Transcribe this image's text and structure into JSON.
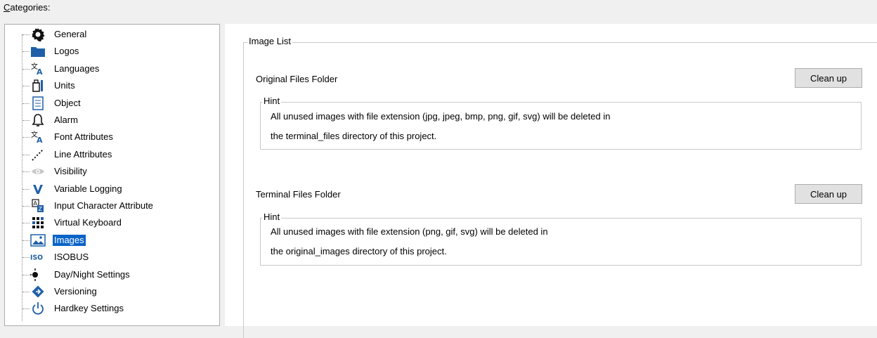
{
  "categories_label_underlined": "C",
  "categories_label_rest": "ategories:",
  "tree": {
    "items": [
      {
        "label": "General",
        "icon": "gear-icon"
      },
      {
        "label": "Logos",
        "icon": "folder-icon"
      },
      {
        "label": "Languages",
        "icon": "language-icon"
      },
      {
        "label": "Units",
        "icon": "units-icon"
      },
      {
        "label": "Object",
        "icon": "document-icon"
      },
      {
        "label": "Alarm",
        "icon": "bell-icon"
      },
      {
        "label": "Font Attributes",
        "icon": "font-icon"
      },
      {
        "label": "Line Attributes",
        "icon": "dotted-line-icon"
      },
      {
        "label": "Visibility",
        "icon": "eye-icon"
      },
      {
        "label": "Variable Logging",
        "icon": "v-icon"
      },
      {
        "label": "Input Character Attribute",
        "icon": "input-char-icon"
      },
      {
        "label": "Virtual Keyboard",
        "icon": "keyboard-icon"
      },
      {
        "label": "Images",
        "icon": "image-icon",
        "selected": true
      },
      {
        "label": "ISOBUS",
        "icon": "iso-icon"
      },
      {
        "label": "Day/Night Settings",
        "icon": "day-night-icon"
      },
      {
        "label": "Versioning",
        "icon": "versioning-icon"
      },
      {
        "label": "Hardkey Settings",
        "icon": "power-icon"
      }
    ]
  },
  "image_list": {
    "title": "Image List",
    "original": {
      "label": "Original Files Folder",
      "button": "Clean up",
      "hint_title": "Hint",
      "hint_line1": "All unused images with file extension (jpg, jpeg, bmp, png, gif, svg) will be deleted in",
      "hint_line2": "the terminal_files directory of this project."
    },
    "terminal": {
      "label": "Terminal Files Folder",
      "button": "Clean up",
      "hint_title": "Hint",
      "hint_line1": "All unused images with file extension (png, gif, svg) will be deleted in",
      "hint_line2": "the original_images directory of this project."
    }
  },
  "colors": {
    "selection": "#0a64c8",
    "accent_blue": "#1f5fa8"
  }
}
